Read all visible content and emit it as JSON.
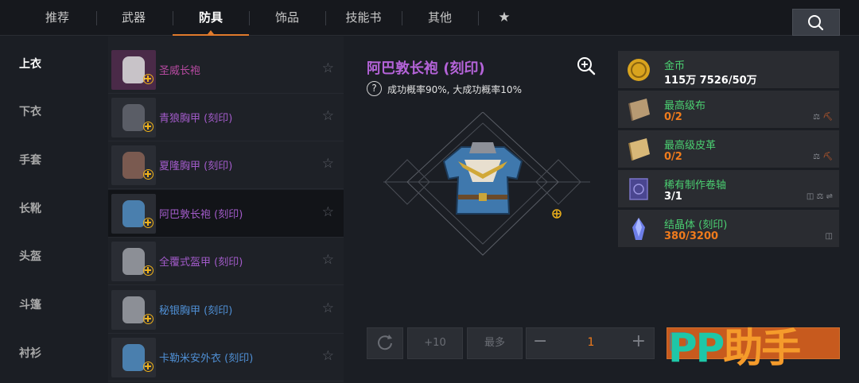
{
  "tabs": [
    {
      "label": "推荐"
    },
    {
      "label": "武器"
    },
    {
      "label": "防具"
    },
    {
      "label": "饰品"
    },
    {
      "label": "技能书"
    },
    {
      "label": "其他"
    }
  ],
  "categories": [
    "上衣",
    "下衣",
    "手套",
    "长靴",
    "头盔",
    "斗篷",
    "衬衫"
  ],
  "items": [
    {
      "name": "圣威长袍",
      "color": "pink"
    },
    {
      "name": "青狼胸甲 (刻印)",
      "color": "purple"
    },
    {
      "name": "夏隆胸甲 (刻印)",
      "color": "purple"
    },
    {
      "name": "阿巴敦长袍 (刻印)",
      "color": "purple"
    },
    {
      "name": "全覆式盔甲 (刻印)",
      "color": "purple"
    },
    {
      "name": "秘银胸甲 (刻印)",
      "color": "blue"
    },
    {
      "name": "卡勒米安外衣 (刻印)",
      "color": "blue"
    }
  ],
  "detail": {
    "title": "阿巴敦长袍 (刻印)",
    "rate_text": "成功概率90%, 大成功概率10%",
    "help_glyph": "?"
  },
  "materials": [
    {
      "name": "金币",
      "count": "115万 7526/50万",
      "count_color": "white",
      "icon": "gold-coin-icon"
    },
    {
      "name": "最高级布",
      "count": "0/2",
      "count_color": "orange",
      "icon": "cloth-icon"
    },
    {
      "name": "最高级皮革",
      "count": "0/2",
      "count_color": "orange",
      "icon": "leather-icon"
    },
    {
      "name": "稀有制作卷轴",
      "count": "3/1",
      "count_color": "white",
      "icon": "scroll-icon"
    },
    {
      "name": "结晶体 (刻印)",
      "count": "380/3200",
      "count_color": "orange",
      "icon": "crystal-icon"
    }
  ],
  "controls": {
    "plus_ten": "+10",
    "max": "最多",
    "quantity": "1",
    "minus": "−",
    "plus": "+"
  },
  "watermark": {
    "part1": "PP",
    "part2": "助手"
  },
  "colors": {
    "accent": "#e07a2c",
    "title_purple": "#b463d8",
    "material_green": "#4bcf71",
    "count_orange": "#f07b1c"
  }
}
